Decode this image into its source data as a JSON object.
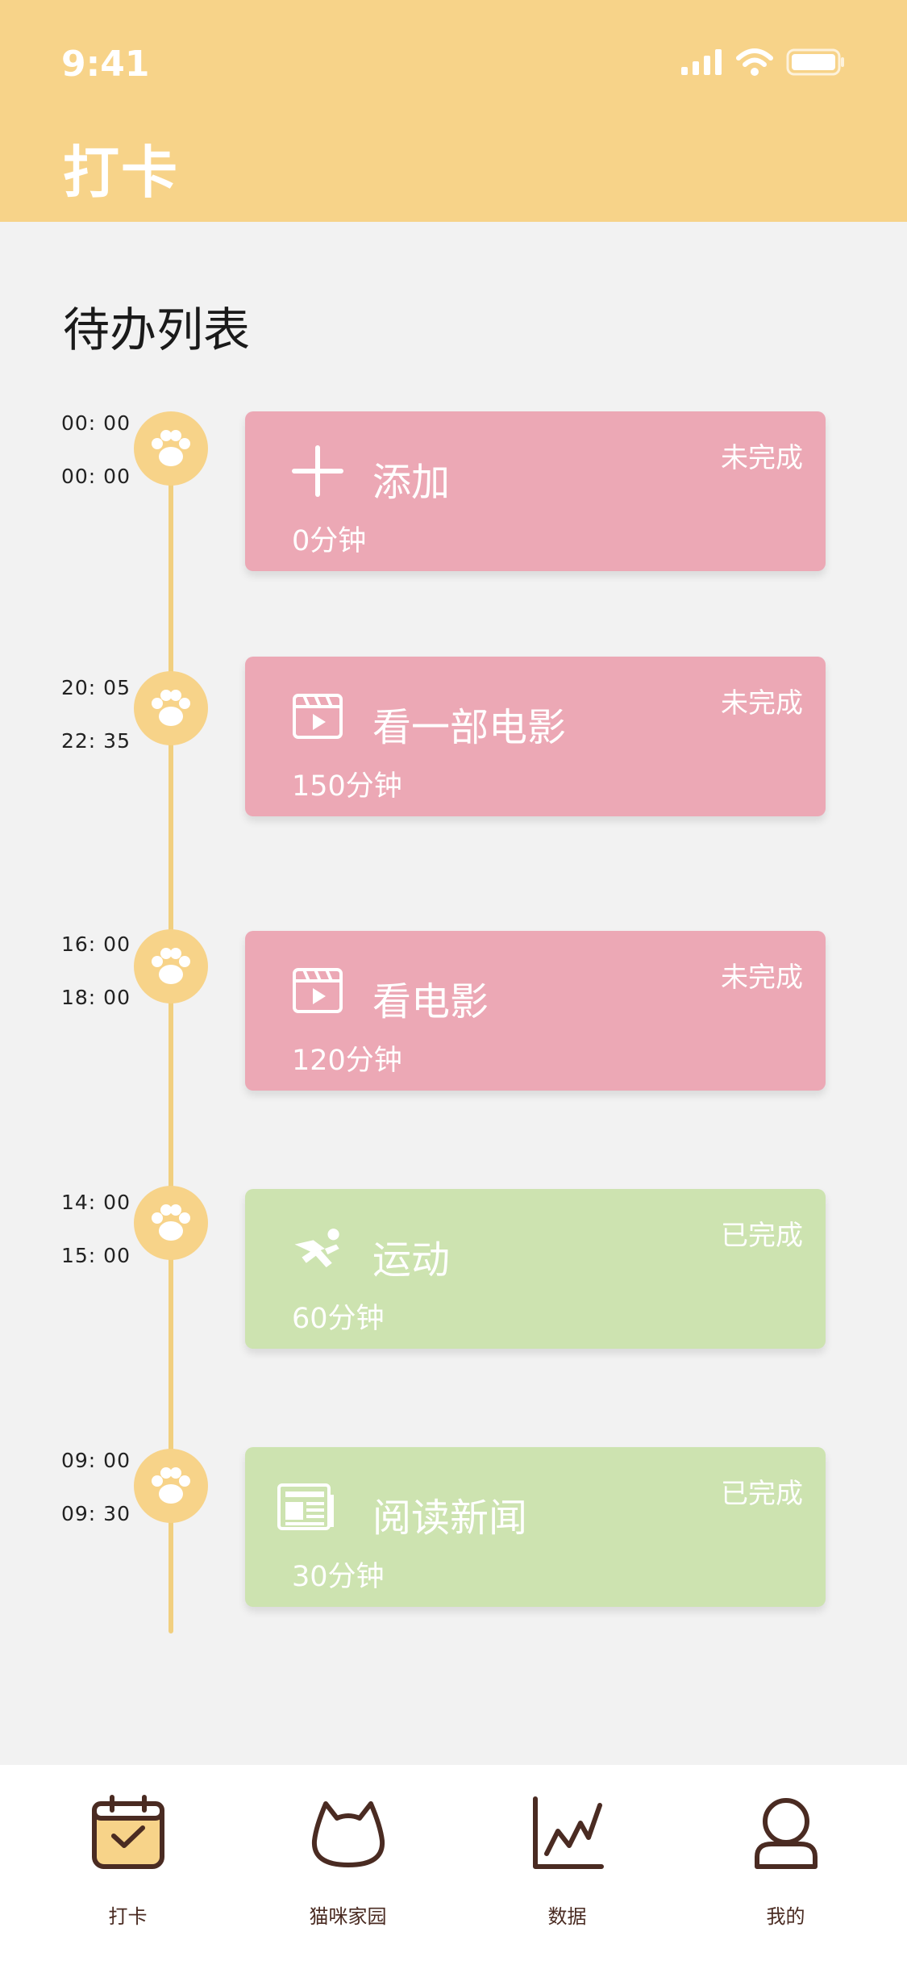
{
  "status_bar": {
    "time": "9:41"
  },
  "header": {
    "title": "打卡"
  },
  "section": {
    "title": "待办列表"
  },
  "tasks": [
    {
      "start": "00: 00",
      "end": "00: 00",
      "title": "添加",
      "duration": "0分钟",
      "status": "未完成",
      "icon": "plus-icon",
      "color": "#eca8b5"
    },
    {
      "start": "20: 05",
      "end": "22: 35",
      "title": "看一部电影",
      "duration": "150分钟",
      "status": "未完成",
      "icon": "film-icon",
      "color": "#eca8b5"
    },
    {
      "start": "16: 00",
      "end": "18: 00",
      "title": "看电影",
      "duration": "120分钟",
      "status": "未完成",
      "icon": "film-icon",
      "color": "#eca8b5"
    },
    {
      "start": "14: 00",
      "end": "15: 00",
      "title": "运动",
      "duration": "60分钟",
      "status": "已完成",
      "icon": "running-icon",
      "color": "#cde3b0"
    },
    {
      "start": "09: 00",
      "end": "09: 30",
      "title": "阅读新闻",
      "duration": "30分钟",
      "status": "已完成",
      "icon": "newspaper-icon",
      "color": "#cde3b0"
    }
  ],
  "tabbar": {
    "items": [
      {
        "label": "打卡",
        "icon": "calendar-check-icon",
        "active": true
      },
      {
        "label": "猫咪家园",
        "icon": "cat-head-icon"
      },
      {
        "label": "数据",
        "icon": "line-chart-icon"
      },
      {
        "label": "我的",
        "icon": "user-icon"
      }
    ]
  },
  "colors": {
    "accent": "#f7d389",
    "pending": "#eca8b5",
    "done": "#cde3b0",
    "tab_icon": "#4a2b22"
  }
}
